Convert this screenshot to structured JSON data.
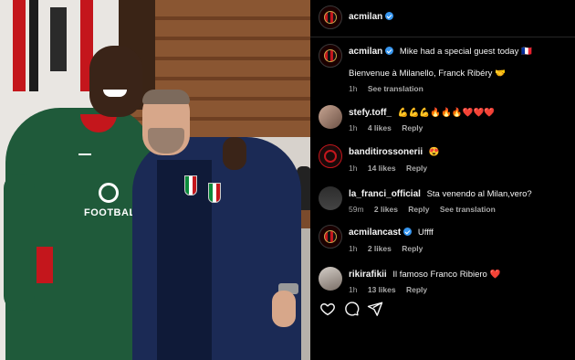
{
  "header": {
    "username": "acmilan",
    "verified": true
  },
  "caption": {
    "username": "acmilan",
    "text": "Mike had a special guest today 🇫🇷",
    "line2": "Bienvenue à Milanello, Franck Ribéry 🤝",
    "time": "1h",
    "see_translation": "See translation"
  },
  "comments": [
    {
      "username": "stefy.toff_",
      "text": "💪💪💪🔥🔥🔥❤️❤️❤️",
      "time": "1h",
      "likes": "4 likes",
      "reply": "Reply"
    },
    {
      "username": "banditirossonerii",
      "text": "😍",
      "time": "1h",
      "likes": "14 likes",
      "reply": "Reply"
    },
    {
      "username": "la_franci_official",
      "text": "Sta venendo al Milan,vero?",
      "time": "59m",
      "likes": "2 likes",
      "reply": "Reply",
      "see_translation": "See translation"
    },
    {
      "username": "acmilancast",
      "verified": true,
      "text": "Uffff",
      "time": "1h",
      "likes": "2 likes",
      "reply": "Reply"
    },
    {
      "username": "rikirafikii",
      "text": "Il famoso Franco Ribiero ❤️",
      "time": "1h",
      "likes": "13 likes",
      "reply": "Reply"
    }
  ],
  "photo": {
    "shirt_text": "FOOTBALL"
  },
  "icons": [
    "heart-icon",
    "comment-icon",
    "share-icon"
  ],
  "colors": {
    "background": "#000000",
    "text": "#f5f5f5",
    "muted": "#a8a8a8",
    "verified": "#3897f0",
    "milan_red": "#c4161c"
  }
}
